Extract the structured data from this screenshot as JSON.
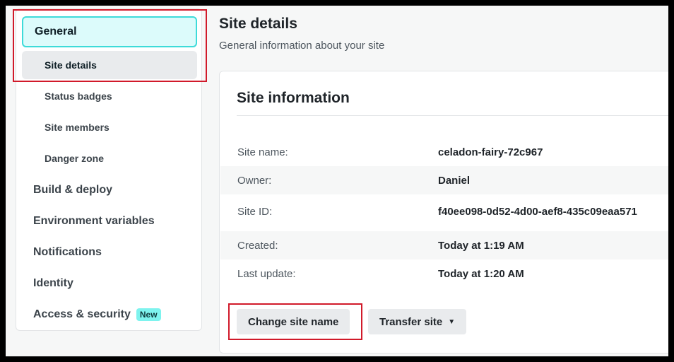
{
  "sidebar": {
    "section_general": "General",
    "sub_items": [
      "Site details",
      "Status badges",
      "Site members",
      "Danger zone"
    ],
    "main_items": [
      "Build & deploy",
      "Environment variables",
      "Notifications",
      "Identity",
      "Access & security"
    ],
    "new_badge": "New"
  },
  "page": {
    "title": "Site details",
    "subtitle": "General information about your site"
  },
  "card": {
    "title": "Site information",
    "rows": [
      {
        "label": "Site name:",
        "value": "celadon-fairy-72c967"
      },
      {
        "label": "Owner:",
        "value": "Daniel"
      },
      {
        "label": "Site ID:",
        "value": "f40ee098-0d52-4d00-aef8-435c09eaa571"
      },
      {
        "label": "Created:",
        "value": "Today at 1:19 AM"
      },
      {
        "label": "Last update:",
        "value": "Today at 1:20 AM"
      }
    ],
    "change_name_button": "Change site name",
    "transfer_button": "Transfer site"
  },
  "colors": {
    "accent_teal": "#3ddbd9",
    "highlight_red": "#d11a2a"
  }
}
